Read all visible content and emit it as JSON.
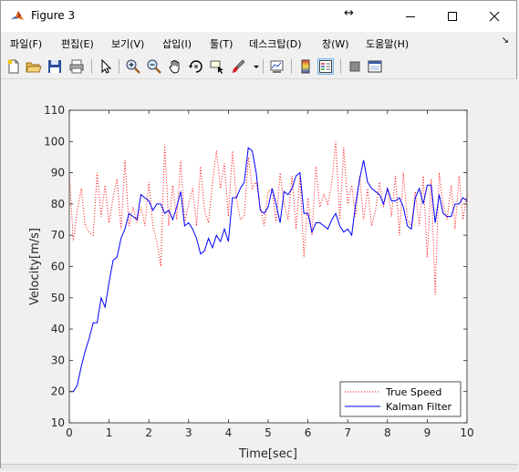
{
  "window": {
    "title": "Figure 3",
    "resize_glyph": "↔"
  },
  "menu": {
    "items": [
      "파일(F)",
      "편집(E)",
      "보기(V)",
      "삽입(I)",
      "툴(T)",
      "데스크탑(D)",
      "창(W)",
      "도움말(H)"
    ],
    "overflow_glyph": "↘"
  },
  "toolbar": {
    "icons": [
      "new-figure-icon",
      "open-file-icon",
      "save-icon",
      "print-icon",
      "pointer-icon",
      "zoom-in-icon",
      "zoom-out-icon",
      "pan-hand-icon",
      "rotate-3d-icon",
      "data-cursor-icon",
      "brush-icon",
      "link-plot-icon",
      "colorbar-icon",
      "legend-icon",
      "hide-plot-tools-icon",
      "show-plot-tools-icon"
    ]
  },
  "chart_data": {
    "type": "line",
    "xlabel": "Time[sec]",
    "ylabel": "Velocity[m/s]",
    "xlim": [
      0,
      10
    ],
    "ylim": [
      10,
      110
    ],
    "xticks": [
      0,
      1,
      2,
      3,
      4,
      5,
      6,
      7,
      8,
      9,
      10
    ],
    "yticks": [
      10,
      20,
      30,
      40,
      50,
      60,
      70,
      80,
      90,
      100,
      110
    ],
    "grid": false,
    "legend_position": "bottom-right",
    "series": [
      {
        "name": "True Speed",
        "color": "#ff0000",
        "style": "dotted",
        "x": [
          0.0,
          0.1,
          0.2,
          0.3,
          0.4,
          0.5,
          0.6,
          0.7,
          0.8,
          0.9,
          1.0,
          1.1,
          1.2,
          1.3,
          1.4,
          1.5,
          1.6,
          1.7,
          1.8,
          1.9,
          2.0,
          2.1,
          2.2,
          2.3,
          2.4,
          2.5,
          2.6,
          2.7,
          2.8,
          2.9,
          3.0,
          3.1,
          3.2,
          3.3,
          3.4,
          3.5,
          3.6,
          3.7,
          3.8,
          3.9,
          4.0,
          4.1,
          4.2,
          4.3,
          4.4,
          4.5,
          4.6,
          4.7,
          4.8,
          4.9,
          5.0,
          5.1,
          5.2,
          5.3,
          5.4,
          5.5,
          5.6,
          5.7,
          5.8,
          5.9,
          6.0,
          6.1,
          6.2,
          6.3,
          6.4,
          6.5,
          6.6,
          6.7,
          6.8,
          6.9,
          7.0,
          7.1,
          7.2,
          7.3,
          7.4,
          7.5,
          7.6,
          7.7,
          7.8,
          7.9,
          8.0,
          8.1,
          8.2,
          8.3,
          8.4,
          8.5,
          8.6,
          8.7,
          8.8,
          8.9,
          9.0,
          9.1,
          9.2,
          9.3,
          9.4,
          9.5,
          9.6,
          9.7,
          9.8,
          9.9,
          10.0
        ],
        "y": [
          90,
          68,
          78,
          85,
          73,
          71,
          70,
          90,
          76,
          86,
          74,
          82,
          88,
          72,
          94,
          73,
          79,
          74,
          79,
          73,
          87,
          73,
          68,
          60,
          99,
          73,
          86,
          75,
          94,
          74,
          80,
          85,
          73,
          92,
          78,
          74,
          87,
          97,
          85,
          93,
          76,
          97,
          82,
          75,
          76,
          95,
          85,
          87,
          79,
          73,
          84,
          85,
          74,
          90,
          80,
          75,
          89,
          72,
          89,
          63,
          82,
          70,
          92,
          79,
          83,
          80,
          87,
          100,
          75,
          98,
          80,
          86,
          76,
          89,
          75,
          85,
          73,
          78,
          87,
          79,
          85,
          76,
          89,
          70,
          90,
          75,
          73,
          84,
          73,
          89,
          63,
          88,
          51,
          90,
          80,
          75,
          86,
          72,
          89,
          75,
          83
        ]
      },
      {
        "name": "Kalman Filter",
        "color": "#0000ff",
        "style": "solid",
        "x": [
          0.0,
          0.1,
          0.2,
          0.3,
          0.4,
          0.5,
          0.6,
          0.7,
          0.8,
          0.9,
          1.0,
          1.1,
          1.2,
          1.3,
          1.4,
          1.5,
          1.6,
          1.7,
          1.8,
          1.9,
          2.0,
          2.1,
          2.2,
          2.3,
          2.4,
          2.5,
          2.6,
          2.7,
          2.8,
          2.9,
          3.0,
          3.1,
          3.2,
          3.3,
          3.4,
          3.5,
          3.6,
          3.7,
          3.8,
          3.9,
          4.0,
          4.1,
          4.2,
          4.3,
          4.4,
          4.5,
          4.6,
          4.7,
          4.8,
          4.9,
          5.0,
          5.1,
          5.2,
          5.3,
          5.4,
          5.5,
          5.6,
          5.7,
          5.8,
          5.9,
          6.0,
          6.1,
          6.2,
          6.3,
          6.4,
          6.5,
          6.6,
          6.7,
          6.8,
          6.9,
          7.0,
          7.1,
          7.2,
          7.3,
          7.4,
          7.5,
          7.6,
          7.7,
          7.8,
          7.9,
          8.0,
          8.1,
          8.2,
          8.3,
          8.4,
          8.5,
          8.6,
          8.7,
          8.8,
          8.9,
          9.0,
          9.1,
          9.2,
          9.3,
          9.4,
          9.5,
          9.6,
          9.7,
          9.8,
          9.9,
          10.0
        ],
        "y": [
          20,
          20,
          22,
          28,
          33,
          37,
          42,
          42,
          50,
          47,
          55,
          62,
          63,
          69,
          72,
          77,
          76,
          75,
          83,
          82,
          81,
          78,
          80,
          80,
          77,
          78,
          75,
          79,
          84,
          73,
          74,
          72,
          69,
          64,
          65,
          69,
          66,
          70,
          68,
          72,
          68,
          82,
          82,
          85,
          87,
          98,
          97,
          90,
          78,
          77,
          79,
          85,
          80,
          74,
          84,
          83,
          85,
          89,
          90,
          77,
          77,
          71,
          74,
          74,
          73,
          72,
          75,
          77,
          73,
          71,
          72,
          70,
          80,
          88,
          94,
          87,
          85,
          84,
          83,
          80,
          85,
          81,
          81,
          82,
          79,
          73,
          72,
          82,
          85,
          80,
          86,
          86,
          74,
          83,
          77,
          76,
          76,
          80,
          80,
          82,
          81
        ]
      }
    ]
  }
}
